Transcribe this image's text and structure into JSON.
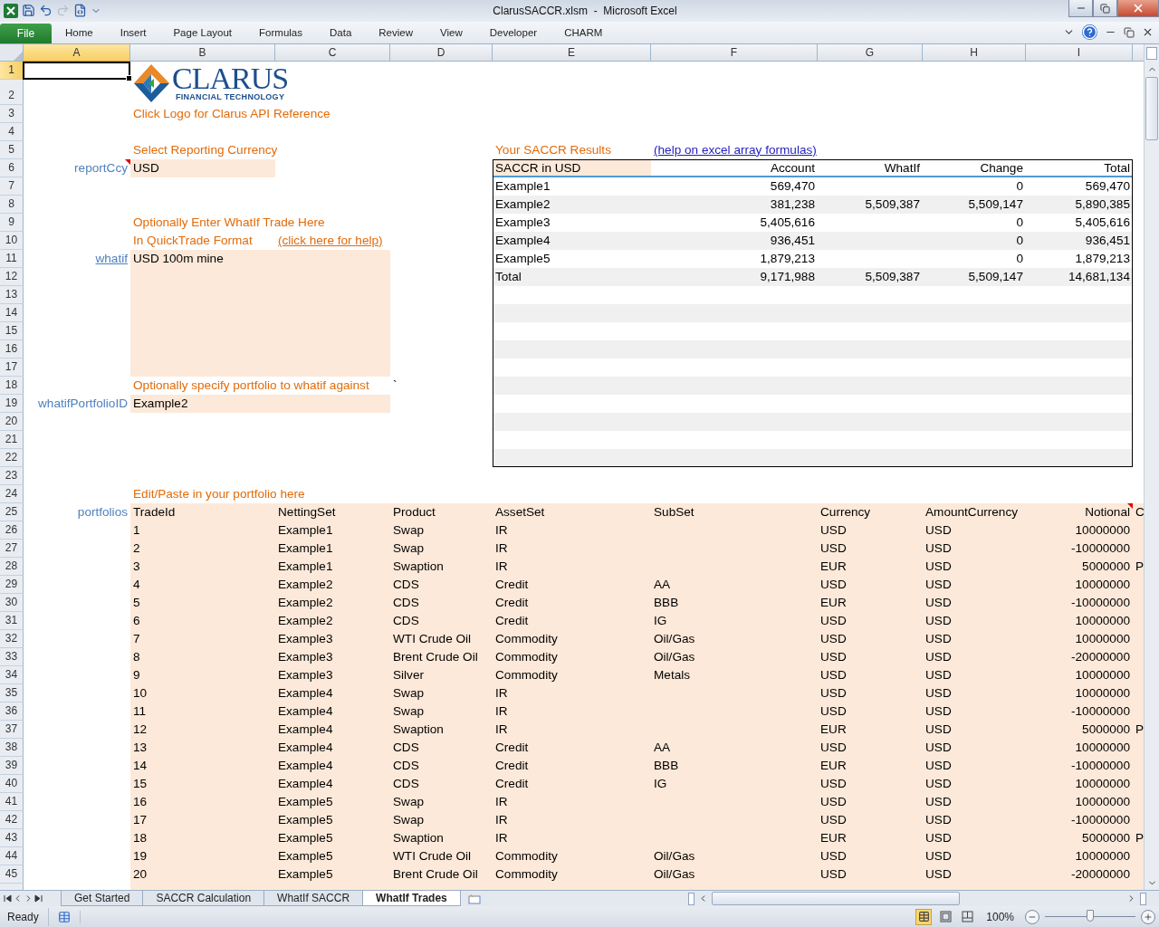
{
  "window": {
    "title": "ClarusSACCR.xlsm  -  Microsoft Excel"
  },
  "quick_access": [
    {
      "kind": "save",
      "disabled": false
    },
    {
      "kind": "undo",
      "disabled": false
    },
    {
      "kind": "redo",
      "disabled": true
    },
    {
      "kind": "macro",
      "disabled": false
    }
  ],
  "ribbon_tabs": [
    {
      "label": "File",
      "kind": "file"
    },
    {
      "label": "Home",
      "kind": "tab"
    },
    {
      "label": "Insert",
      "kind": "tab"
    },
    {
      "label": "Page Layout",
      "kind": "tab"
    },
    {
      "label": "Formulas",
      "kind": "tab"
    },
    {
      "label": "Data",
      "kind": "tab"
    },
    {
      "label": "Review",
      "kind": "tab"
    },
    {
      "label": "View",
      "kind": "tab"
    },
    {
      "label": "Developer",
      "kind": "tab"
    },
    {
      "label": "CHARM",
      "kind": "tab"
    }
  ],
  "columns": [
    {
      "label": "A",
      "selected": true
    },
    {
      "label": "B",
      "selected": false
    },
    {
      "label": "C",
      "selected": false
    },
    {
      "label": "D",
      "selected": false
    },
    {
      "label": "E",
      "selected": false
    },
    {
      "label": "F",
      "selected": false
    },
    {
      "label": "G",
      "selected": false
    },
    {
      "label": "H",
      "selected": false
    },
    {
      "label": "I",
      "selected": false
    }
  ],
  "rows": [
    {
      "label": "1",
      "selected": true
    },
    {
      "label": "2",
      "selected": false
    },
    {
      "label": "3",
      "selected": false
    },
    {
      "label": "4",
      "selected": false
    },
    {
      "label": "5",
      "selected": false
    },
    {
      "label": "6",
      "selected": false
    },
    {
      "label": "7",
      "selected": false
    },
    {
      "label": "8",
      "selected": false
    },
    {
      "label": "9",
      "selected": false
    },
    {
      "label": "10",
      "selected": false
    },
    {
      "label": "11",
      "selected": false
    },
    {
      "label": "12",
      "selected": false
    },
    {
      "label": "13",
      "selected": false
    },
    {
      "label": "14",
      "selected": false
    },
    {
      "label": "15",
      "selected": false
    },
    {
      "label": "16",
      "selected": false
    },
    {
      "label": "17",
      "selected": false
    },
    {
      "label": "18",
      "selected": false
    },
    {
      "label": "19",
      "selected": false
    },
    {
      "label": "20",
      "selected": false
    },
    {
      "label": "21",
      "selected": false
    },
    {
      "label": "22",
      "selected": false
    },
    {
      "label": "23",
      "selected": false
    },
    {
      "label": "24",
      "selected": false
    },
    {
      "label": "25",
      "selected": false
    },
    {
      "label": "26",
      "selected": false
    },
    {
      "label": "27",
      "selected": false
    },
    {
      "label": "28",
      "selected": false
    },
    {
      "label": "29",
      "selected": false
    },
    {
      "label": "30",
      "selected": false
    },
    {
      "label": "31",
      "selected": false
    },
    {
      "label": "32",
      "selected": false
    },
    {
      "label": "33",
      "selected": false
    },
    {
      "label": "34",
      "selected": false
    },
    {
      "label": "35",
      "selected": false
    },
    {
      "label": "36",
      "selected": false
    },
    {
      "label": "37",
      "selected": false
    },
    {
      "label": "38",
      "selected": false
    },
    {
      "label": "39",
      "selected": false
    },
    {
      "label": "40",
      "selected": false
    },
    {
      "label": "41",
      "selected": false
    },
    {
      "label": "42",
      "selected": false
    },
    {
      "label": "43",
      "selected": false
    },
    {
      "label": "44",
      "selected": false
    },
    {
      "label": "45",
      "selected": false
    }
  ],
  "sheet": {
    "logo": {
      "name": "CLARUS",
      "tagline": "FINANCIAL TECHNOLOGY"
    },
    "logo_caption": "Click Logo for Clarus API Reference",
    "currency": {
      "heading": "Select Reporting Currency",
      "name": "reportCcy",
      "has_comment": true,
      "value": "USD"
    },
    "whatif": {
      "heading": "Optionally Enter WhatIf Trade Here",
      "format_note": "In QuickTrade Format",
      "help_link": "(click here for help)",
      "name": "whatif",
      "value": "USD 100m mine"
    },
    "portfolio_choice": {
      "heading": "Optionally specify portfolio to whatif against",
      "stray_mark": "`",
      "name": "whatifPortfolioID",
      "value": "Example2"
    },
    "results": {
      "heading": "Your SACCR Results",
      "help_link": "(help on excel array formulas)",
      "columns": [
        "SACCR in USD",
        "Account",
        "WhatIf",
        "Change",
        "Total"
      ],
      "rows": [
        [
          "Example1",
          "569,470",
          null,
          "0",
          "569,470"
        ],
        [
          "Example2",
          "381,238",
          "5,509,387",
          "5,509,147",
          "5,890,385"
        ],
        [
          "Example3",
          "5,405,616",
          null,
          "0",
          "5,405,616"
        ],
        [
          "Example4",
          "936,451",
          null,
          "0",
          "936,451"
        ],
        [
          "Example5",
          "1,879,213",
          null,
          "0",
          "1,879,213"
        ],
        [
          "Total",
          "9,171,988",
          "5,509,387",
          "5,509,147",
          "14,681,134"
        ]
      ]
    },
    "portfolio": {
      "heading": "Edit/Paste in your portfolio here",
      "name": "portfolios",
      "columns": [
        {
          "label": "TradeId",
          "kind": "text",
          "has_comment": false
        },
        {
          "label": "NettingSet",
          "kind": "text",
          "has_comment": false
        },
        {
          "label": "Product",
          "kind": "text",
          "has_comment": false
        },
        {
          "label": "AssetSet",
          "kind": "text",
          "has_comment": false
        },
        {
          "label": "SubSet",
          "kind": "text",
          "has_comment": false
        },
        {
          "label": "Currency",
          "kind": "text",
          "has_comment": false
        },
        {
          "label": "AmountCurrency",
          "kind": "text",
          "has_comment": false
        },
        {
          "label": "Notional",
          "kind": "number",
          "has_comment": true
        },
        {
          "label": "C",
          "kind": "text",
          "has_comment": false
        }
      ],
      "rows": [
        [
          "1",
          "Example1",
          "Swap",
          "IR",
          null,
          "USD",
          "USD",
          "10000000",
          null
        ],
        [
          "2",
          "Example1",
          "Swap",
          "IR",
          null,
          "USD",
          "USD",
          "-10000000",
          null
        ],
        [
          "3",
          "Example1",
          "Swaption",
          "IR",
          null,
          "EUR",
          "USD",
          "5000000",
          "P"
        ],
        [
          "4",
          "Example2",
          "CDS",
          "Credit",
          "AA",
          "USD",
          "USD",
          "10000000",
          null
        ],
        [
          "5",
          "Example2",
          "CDS",
          "Credit",
          "BBB",
          "EUR",
          "USD",
          "-10000000",
          null
        ],
        [
          "6",
          "Example2",
          "CDS",
          "Credit",
          "IG",
          "USD",
          "USD",
          "10000000",
          null
        ],
        [
          "7",
          "Example3",
          "WTI Crude Oil",
          "Commodity",
          "Oil/Gas",
          "USD",
          "USD",
          "10000000",
          null
        ],
        [
          "8",
          "Example3",
          "Brent Crude Oil",
          "Commodity",
          "Oil/Gas",
          "USD",
          "USD",
          "-20000000",
          null
        ],
        [
          "9",
          "Example3",
          "Silver",
          "Commodity",
          "Metals",
          "USD",
          "USD",
          "10000000",
          null
        ],
        [
          "10",
          "Example4",
          "Swap",
          "IR",
          null,
          "USD",
          "USD",
          "10000000",
          null
        ],
        [
          "11",
          "Example4",
          "Swap",
          "IR",
          null,
          "USD",
          "USD",
          "-10000000",
          null
        ],
        [
          "12",
          "Example4",
          "Swaption",
          "IR",
          null,
          "EUR",
          "USD",
          "5000000",
          "P"
        ],
        [
          "13",
          "Example4",
          "CDS",
          "Credit",
          "AA",
          "USD",
          "USD",
          "10000000",
          null
        ],
        [
          "14",
          "Example4",
          "CDS",
          "Credit",
          "BBB",
          "EUR",
          "USD",
          "-10000000",
          null
        ],
        [
          "15",
          "Example4",
          "CDS",
          "Credit",
          "IG",
          "USD",
          "USD",
          "10000000",
          null
        ],
        [
          "16",
          "Example5",
          "Swap",
          "IR",
          null,
          "USD",
          "USD",
          "10000000",
          null
        ],
        [
          "17",
          "Example5",
          "Swap",
          "IR",
          null,
          "USD",
          "USD",
          "-10000000",
          null
        ],
        [
          "18",
          "Example5",
          "Swaption",
          "IR",
          null,
          "EUR",
          "USD",
          "5000000",
          "P"
        ],
        [
          "19",
          "Example5",
          "WTI Crude Oil",
          "Commodity",
          "Oil/Gas",
          "USD",
          "USD",
          "10000000",
          null
        ],
        [
          "20",
          "Example5",
          "Brent Crude Oil",
          "Commodity",
          "Oil/Gas",
          "USD",
          "USD",
          "-20000000",
          null
        ]
      ]
    }
  },
  "sheet_tabs": [
    {
      "label": "Get Started",
      "selected": false
    },
    {
      "label": "SACCR Calculation",
      "selected": false
    },
    {
      "label": "WhatIf SACCR",
      "selected": false
    },
    {
      "label": "WhatIf Trades",
      "selected": true
    }
  ],
  "status_bar": {
    "mode": "Ready",
    "views": [
      {
        "kind": "normal",
        "selected": true
      },
      {
        "kind": "page_layout",
        "selected": false
      },
      {
        "kind": "page_break",
        "selected": false
      }
    ],
    "zoom": "100%",
    "zoom_slider": {
      "level": 0.5
    }
  }
}
